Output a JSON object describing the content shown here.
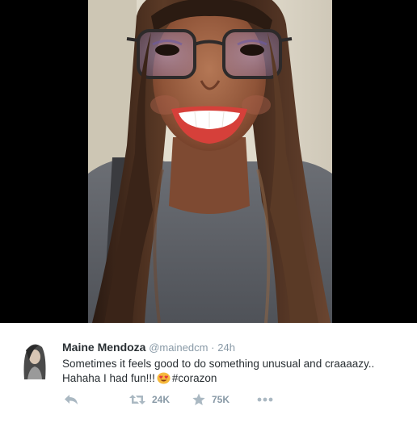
{
  "tweet": {
    "author_name": "Maine Mendoza",
    "handle": "@mainedcm",
    "separator": "·",
    "time": "24h",
    "text_line1": "Sometimes it feels good to do something unusual and craaaazy..",
    "text_line2_prefix": "Hahaha I had fun!!!",
    "emoji": "smiling-face-with-heart-eyes",
    "hashtag": "#corazon"
  },
  "actions": {
    "reply_icon": "reply-arrow-icon",
    "retweet_icon": "retweet-icon",
    "retweet_count": "24K",
    "favorite_icon": "star-icon",
    "favorite_count": "75K",
    "more_icon": "more-dots-icon"
  },
  "colors": {
    "media_background": "#000000",
    "text": "#292f33",
    "muted": "#8899a6",
    "action_icon": "#aab8c2"
  }
}
